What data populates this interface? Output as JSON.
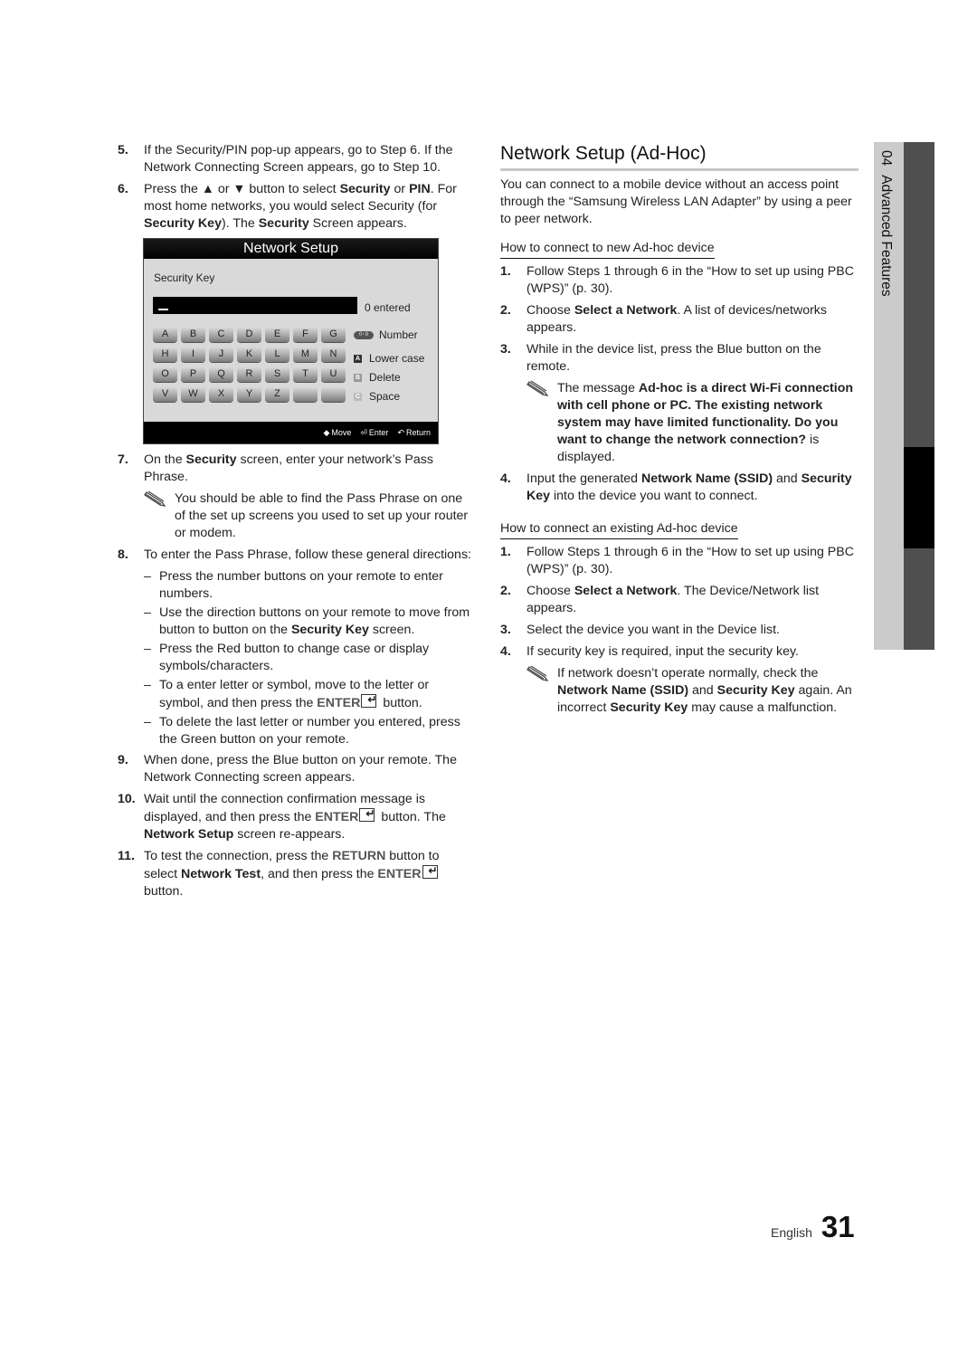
{
  "left": {
    "step5": {
      "num": "5.",
      "text": "If the Security/PIN pop-up appears, go to Step 6. If the Network Connecting Screen appears, go to Step 10."
    },
    "step6": {
      "num": "6.",
      "p1": "Press the ▲ or ▼ button to select ",
      "b1": "Security",
      "p2": " or ",
      "b2": "PIN",
      "p3": ". For most home networks, you would select Security (for ",
      "b3": "Security Key",
      "p4": "). The ",
      "b4": "Security",
      "p5": " Screen appears."
    },
    "tv_screen": {
      "title": "Network Setup",
      "field_label": "Security Key",
      "entered": "0 entered",
      "keys": [
        "A",
        "B",
        "C",
        "D",
        "E",
        "F",
        "G",
        "H",
        "I",
        "J",
        "K",
        "L",
        "M",
        "N",
        "O",
        "P",
        "Q",
        "R",
        "S",
        "T",
        "U",
        "V",
        "W",
        "X",
        "Y",
        "Z",
        "",
        ""
      ],
      "legend": [
        {
          "icon": "0~9",
          "label": "Number"
        },
        {
          "icon": "A",
          "label": "Lower case",
          "color": "#333333"
        },
        {
          "icon": "B",
          "label": "Delete",
          "color": "#999999"
        },
        {
          "icon": "C",
          "label": "Space",
          "color": "#bbbbbb"
        }
      ],
      "footer": {
        "move": "Move",
        "enter": "Enter",
        "return": "Return"
      }
    },
    "step7": {
      "num": "7.",
      "p1": "On the ",
      "b1": "Security",
      "p2": " screen, enter your network’s Pass Phrase.",
      "note": "You should be able to find the Pass Phrase on one of the set up screens you used to set up your router or modem."
    },
    "step8": {
      "num": "8.",
      "text": "To enter the Pass Phrase, follow these general directions:"
    },
    "dashes": {
      "d1": "Press the number buttons on your remote to enter numbers.",
      "d2a": "Use the direction buttons on your remote to move from button to button on the ",
      "d2b": "Security Key",
      "d2c": " screen.",
      "d3": "Press the Red button to change case or display symbols/characters.",
      "d4a": "To a enter letter or symbol, move to the letter or symbol, and then press the ",
      "d4b": "ENTER",
      "d4c": " button.",
      "d5": "To delete the last letter or number you entered, press the Green button on your remote."
    },
    "step9": {
      "num": "9.",
      "text": "When done, press the Blue button on your remote. The Network Connecting screen appears."
    },
    "step10": {
      "num": "10.",
      "p1": "Wait until the connection confirmation message is displayed, and then press the ",
      "b1": "ENTER",
      "p2": " button. The ",
      "b2": "Network Setup",
      "p3": " screen re-appears."
    },
    "step11": {
      "num": "11.",
      "p1": "To test the connection, press the ",
      "b1": "RETURN",
      "p2": " button to select ",
      "b2": "Network Test",
      "p3": ", and then press the ",
      "b3": "ENTER",
      "p4": " button."
    }
  },
  "right": {
    "title": "Network Setup (Ad-Hoc)",
    "intro": "You can connect to a mobile device without an access point through the “Samsung Wireless LAN Adapter” by using a peer to peer network.",
    "section1": {
      "heading": "How to connect to new Ad-hoc device",
      "s1": {
        "num": "1.",
        "text": "Follow Steps 1 through 6 in the “How to set up using PBC (WPS)” (p. 30)."
      },
      "s2": {
        "num": "2.",
        "p1": "Choose ",
        "b1": "Select a Network",
        "p2": ". A list of devices/networks appears."
      },
      "s3": {
        "num": "3.",
        "text": "While in the device list, press the Blue button on the remote.",
        "note_p1": "The message ",
        "note_b1": "Ad-hoc is a direct Wi-Fi connection with cell phone or PC. The existing network system may have limited functionality. Do you want to change the network connection?",
        "note_p2": " is displayed."
      },
      "s4": {
        "num": "4.",
        "p1": "Input the generated ",
        "b1": "Network Name (SSID)",
        "p2": " and ",
        "b2": "Security Key",
        "p3": " into the device you want to connect."
      }
    },
    "section2": {
      "heading": "How to connect an existing Ad-hoc device",
      "s1": {
        "num": "1.",
        "text": "Follow Steps 1 through 6 in the “How to set up using PBC (WPS)” (p. 30)."
      },
      "s2": {
        "num": "2.",
        "p1": "Choose ",
        "b1": "Select a Network",
        "p2": ". The Device/Network list appears."
      },
      "s3": {
        "num": "3.",
        "text": "Select the device you want in the Device list."
      },
      "s4": {
        "num": "4.",
        "text": "If security key is required, input the security key.",
        "note_p1": "If network doesn’t operate normally, check the ",
        "note_b1": "Network Name (SSID)",
        "note_p2": " and ",
        "note_b2": "Security Key",
        "note_p3": " again. An incorrect ",
        "note_b3": "Security Key",
        "note_p4": " may cause a malfunction."
      }
    }
  },
  "side_tab": {
    "chapter": "04",
    "label": "Advanced Features"
  },
  "footer": {
    "language": "English",
    "page": "31"
  }
}
